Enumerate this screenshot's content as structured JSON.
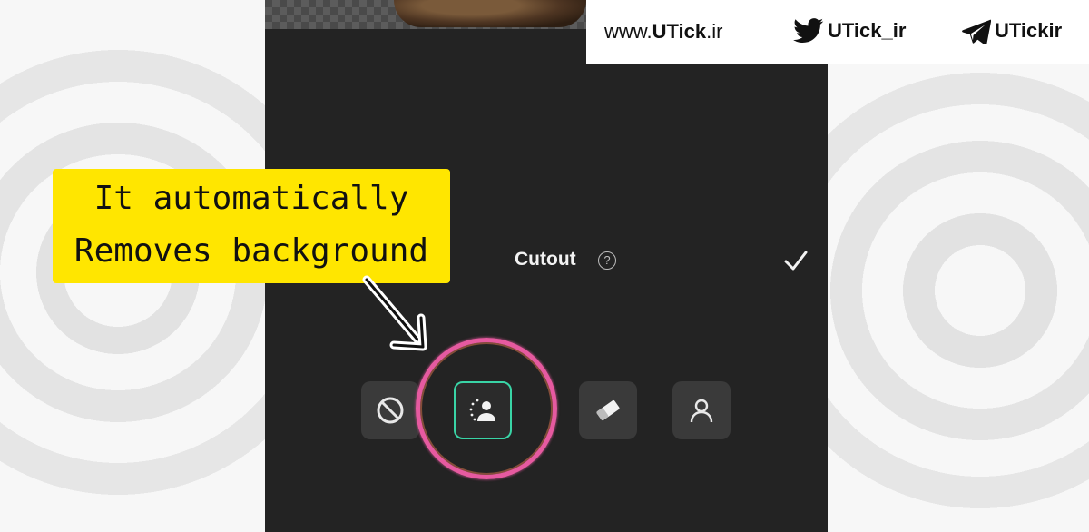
{
  "watermark": {
    "site_prefix": "www.",
    "site_bold": "UTick",
    "site_suffix": ".ir",
    "twitter_handle": "UTick_ir",
    "telegram_handle": "UTickir"
  },
  "annotation": {
    "line1": "It automatically",
    "line2": "Removes background",
    "highlight_color": "#e65aa0",
    "callout_color": "#ffe600"
  },
  "panel": {
    "title": "Cutout",
    "help_icon": "question-circle-icon",
    "confirm_icon": "checkmark-icon"
  },
  "tools": [
    {
      "name": "none",
      "icon": "prohibited-icon",
      "selected": false
    },
    {
      "name": "auto-cutout",
      "icon": "person-cutout-icon",
      "selected": true
    },
    {
      "name": "eraser",
      "icon": "eraser-icon",
      "selected": false
    },
    {
      "name": "person",
      "icon": "person-outline-icon",
      "selected": false
    }
  ],
  "colors": {
    "panel_bg": "#232323",
    "accent": "#39d4a6"
  }
}
